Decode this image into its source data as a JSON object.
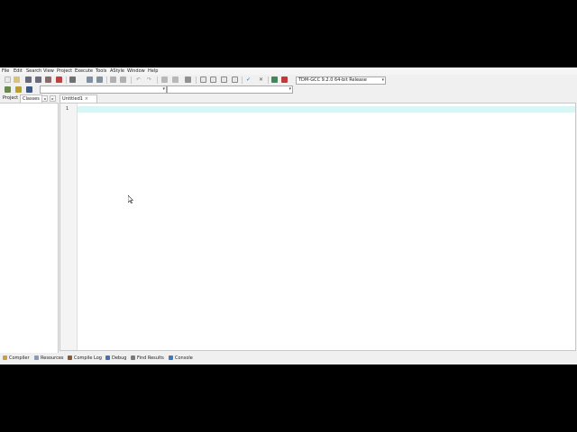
{
  "menu": {
    "items": [
      "File",
      "Edit",
      "Search",
      "View",
      "Project",
      "Execute",
      "Tools",
      "AStyle",
      "Window",
      "Help"
    ]
  },
  "toolbar": {
    "compiler_select": "TDM-GCC 9.2.0 64-bit Release",
    "icons": [
      "new-file-icon",
      "open-file-icon",
      "save-icon",
      "save-all-icon",
      "close-file-icon",
      "close-all-icon",
      "print-icon",
      "print-preview-icon",
      "undo-icon",
      "redo-icon",
      "find-icon",
      "replace-icon",
      "indent-icon",
      "unindent-icon",
      "bookmark-icon",
      "new-project-icon",
      "add-file-icon",
      "remove-file-icon",
      "project-options-icon",
      "check-syntax-icon",
      "stop-icon",
      "profile-icon",
      "debug-icon"
    ]
  },
  "toolbar2": {
    "class_combo": "",
    "member_combo": ""
  },
  "left_panel": {
    "tabs": [
      "Project",
      "Classes"
    ],
    "active_tab": "Classes"
  },
  "editor": {
    "tab_label": "Untitled1",
    "tab_close": "×",
    "line_numbers": [
      "1"
    ]
  },
  "bottom_tabs": [
    {
      "label": "Compiler",
      "color": "#c9a040"
    },
    {
      "label": "Resources",
      "color": "#8a9ab0"
    },
    {
      "label": "Compile Log",
      "color": "#8a5a30"
    },
    {
      "label": "Debug",
      "color": "#4a70b0"
    },
    {
      "label": "Find Results",
      "color": "#7a7a7a"
    },
    {
      "label": "Console",
      "color": "#3a7ac0"
    }
  ],
  "colors": {
    "active_line": "#d8f6f6",
    "accent": "#2a5fb0"
  }
}
